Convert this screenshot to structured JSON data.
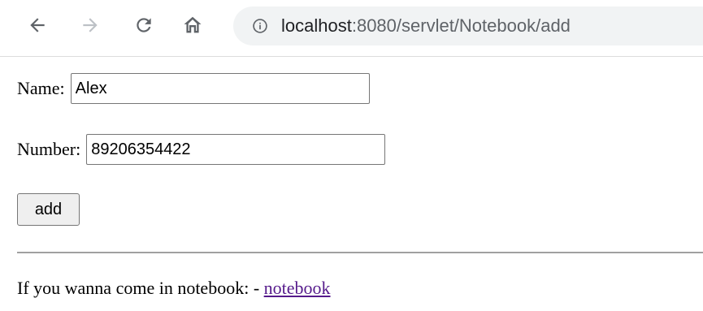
{
  "browser": {
    "url_host": "localhost",
    "url_rest": ":8080/servlet/Notebook/add",
    "icons": {
      "back": "arrow-left-icon",
      "forward": "arrow-right-icon",
      "reload": "reload-icon",
      "home": "home-icon",
      "info": "info-icon"
    }
  },
  "form": {
    "name_label": "Name:",
    "name_value": "Alex",
    "number_label": "Number:",
    "number_value": "89206354422",
    "submit_label": "add"
  },
  "footer": {
    "text": "If you wanna come in notebook: - ",
    "link_label": "notebook"
  },
  "colors": {
    "visited_link": "#551a8b",
    "omnibox_bg": "#f1f3f4"
  }
}
